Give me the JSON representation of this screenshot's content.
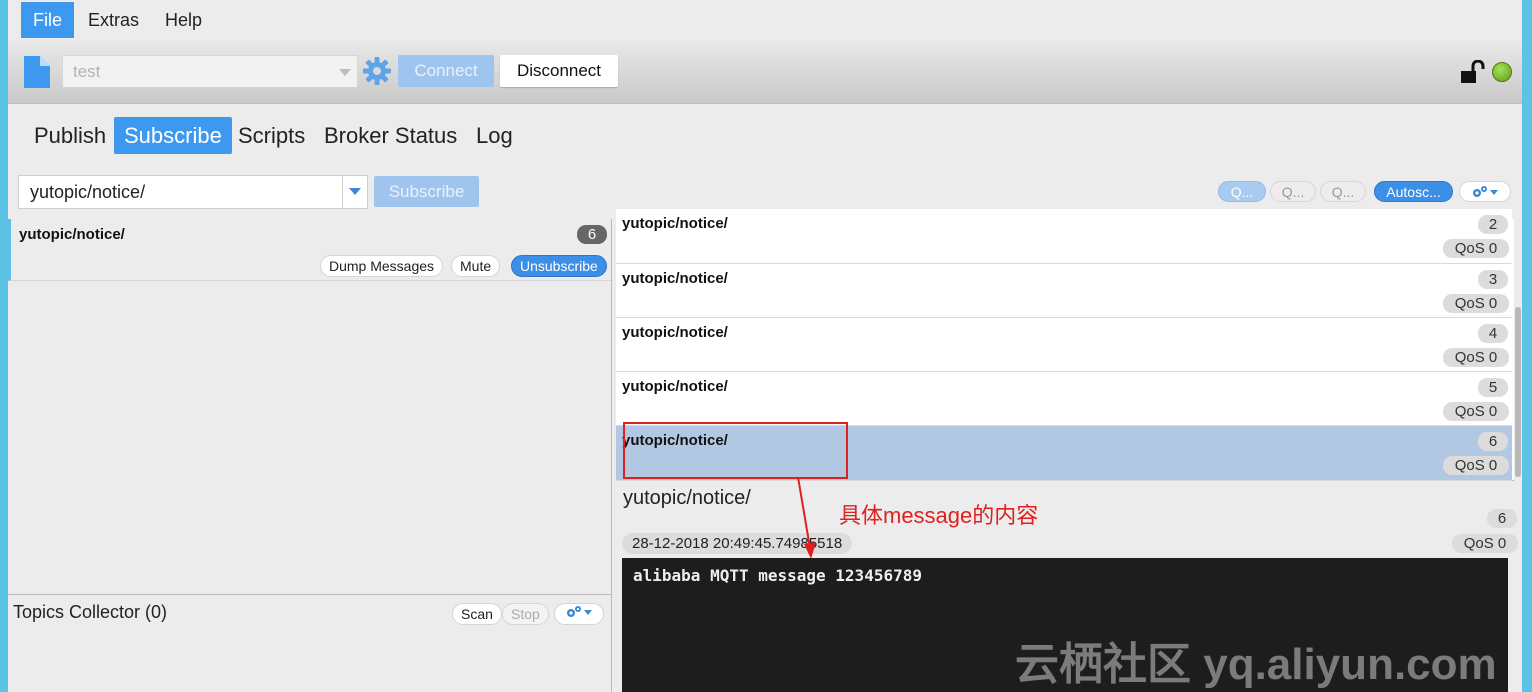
{
  "menubar": {
    "items": [
      "File",
      "Extras",
      "Help"
    ]
  },
  "toolbar": {
    "profile_value": "test",
    "connect_label": "Connect",
    "disconnect_label": "Disconnect"
  },
  "tabs": [
    "Publish",
    "Subscribe",
    "Scripts",
    "Broker Status",
    "Log"
  ],
  "subscribe_bar": {
    "topic_value": "yutopic/notice/",
    "subscribe_label": "Subscribe",
    "filter_buttons": [
      "Q...",
      "Q...",
      "Q..."
    ],
    "autoscroll_label": "Autosc..."
  },
  "subscriptions": [
    {
      "topic": "yutopic/notice/",
      "count": "6",
      "dump_label": "Dump Messages",
      "mute_label": "Mute",
      "unsubscribe_label": "Unsubscribe"
    }
  ],
  "topics_collector": {
    "title": "Topics Collector (0)",
    "scan_label": "Scan",
    "stop_label": "Stop"
  },
  "messages": [
    {
      "topic": "yutopic/notice/",
      "number": "2",
      "qos": "QoS 0"
    },
    {
      "topic": "yutopic/notice/",
      "number": "3",
      "qos": "QoS 0"
    },
    {
      "topic": "yutopic/notice/",
      "number": "4",
      "qos": "QoS 0"
    },
    {
      "topic": "yutopic/notice/",
      "number": "5",
      "qos": "QoS 0"
    },
    {
      "topic": "yutopic/notice/",
      "number": "6",
      "qos": "QoS 0",
      "selected": true
    }
  ],
  "detail": {
    "topic": "yutopic/notice/",
    "number": "6",
    "timestamp": "28-12-2018  20:49:45.74985518",
    "qos": "QoS 0",
    "payload": "alibaba MQTT message 123456789"
  },
  "annotation": {
    "text": "具体message的内容",
    "color": "#e02020"
  },
  "watermark": "云栖社区 yq.aliyun.com",
  "colors": {
    "accent": "#3d99f0",
    "selected_row": "#b2c7e1",
    "connected": "#6fb524"
  }
}
